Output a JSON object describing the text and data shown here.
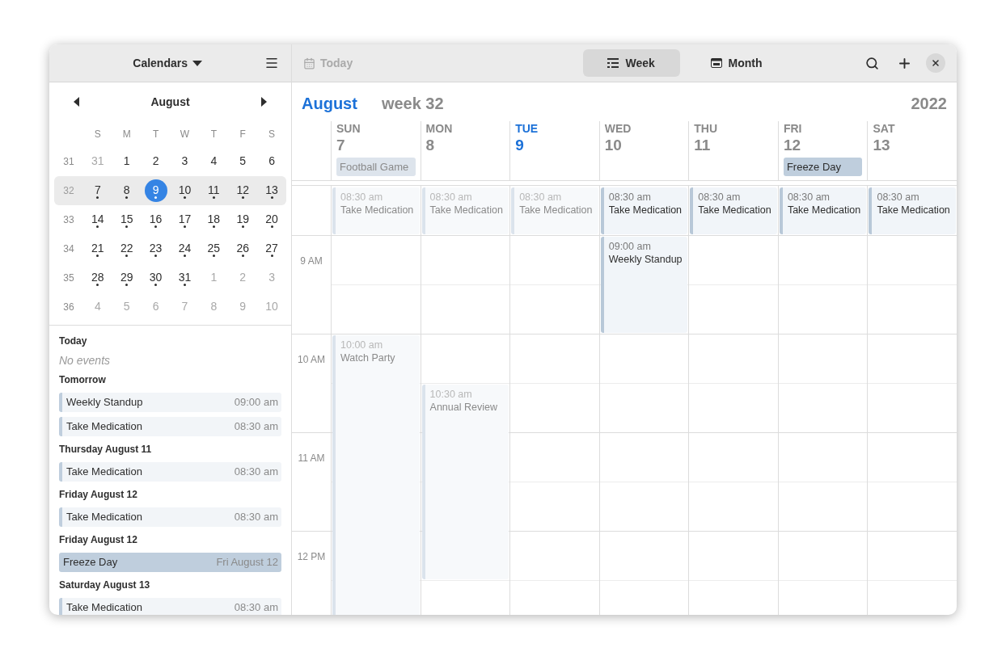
{
  "sidebar": {
    "header": {
      "title": "Calendars"
    },
    "mini_calendar": {
      "month": "August",
      "weekdays": [
        "S",
        "M",
        "T",
        "W",
        "T",
        "F",
        "S"
      ],
      "weeks": [
        {
          "number": "31",
          "current": false,
          "days": [
            {
              "label": "31",
              "other_month": true,
              "has_events": false,
              "selected": false
            },
            {
              "label": "1",
              "other_month": false,
              "has_events": false,
              "selected": false
            },
            {
              "label": "2",
              "other_month": false,
              "has_events": false,
              "selected": false
            },
            {
              "label": "3",
              "other_month": false,
              "has_events": false,
              "selected": false
            },
            {
              "label": "4",
              "other_month": false,
              "has_events": false,
              "selected": false
            },
            {
              "label": "5",
              "other_month": false,
              "has_events": false,
              "selected": false
            },
            {
              "label": "6",
              "other_month": false,
              "has_events": false,
              "selected": false
            }
          ]
        },
        {
          "number": "32",
          "current": true,
          "days": [
            {
              "label": "7",
              "other_month": false,
              "has_events": true,
              "selected": false
            },
            {
              "label": "8",
              "other_month": false,
              "has_events": true,
              "selected": false
            },
            {
              "label": "9",
              "other_month": false,
              "has_events": true,
              "selected": true
            },
            {
              "label": "10",
              "other_month": false,
              "has_events": true,
              "selected": false
            },
            {
              "label": "11",
              "other_month": false,
              "has_events": true,
              "selected": false
            },
            {
              "label": "12",
              "other_month": false,
              "has_events": true,
              "selected": false
            },
            {
              "label": "13",
              "other_month": false,
              "has_events": true,
              "selected": false
            }
          ]
        },
        {
          "number": "33",
          "current": false,
          "days": [
            {
              "label": "14",
              "other_month": false,
              "has_events": true,
              "selected": false
            },
            {
              "label": "15",
              "other_month": false,
              "has_events": true,
              "selected": false
            },
            {
              "label": "16",
              "other_month": false,
              "has_events": true,
              "selected": false
            },
            {
              "label": "17",
              "other_month": false,
              "has_events": true,
              "selected": false
            },
            {
              "label": "18",
              "other_month": false,
              "has_events": true,
              "selected": false
            },
            {
              "label": "19",
              "other_month": false,
              "has_events": true,
              "selected": false
            },
            {
              "label": "20",
              "other_month": false,
              "has_events": true,
              "selected": false
            }
          ]
        },
        {
          "number": "34",
          "current": false,
          "days": [
            {
              "label": "21",
              "other_month": false,
              "has_events": true,
              "selected": false
            },
            {
              "label": "22",
              "other_month": false,
              "has_events": true,
              "selected": false
            },
            {
              "label": "23",
              "other_month": false,
              "has_events": true,
              "selected": false
            },
            {
              "label": "24",
              "other_month": false,
              "has_events": true,
              "selected": false
            },
            {
              "label": "25",
              "other_month": false,
              "has_events": true,
              "selected": false
            },
            {
              "label": "26",
              "other_month": false,
              "has_events": true,
              "selected": false
            },
            {
              "label": "27",
              "other_month": false,
              "has_events": true,
              "selected": false
            }
          ]
        },
        {
          "number": "35",
          "current": false,
          "days": [
            {
              "label": "28",
              "other_month": false,
              "has_events": true,
              "selected": false
            },
            {
              "label": "29",
              "other_month": false,
              "has_events": true,
              "selected": false
            },
            {
              "label": "30",
              "other_month": false,
              "has_events": true,
              "selected": false
            },
            {
              "label": "31",
              "other_month": false,
              "has_events": true,
              "selected": false
            },
            {
              "label": "1",
              "other_month": true,
              "has_events": false,
              "selected": false
            },
            {
              "label": "2",
              "other_month": true,
              "has_events": false,
              "selected": false
            },
            {
              "label": "3",
              "other_month": true,
              "has_events": false,
              "selected": false
            }
          ]
        },
        {
          "number": "36",
          "current": false,
          "days": [
            {
              "label": "4",
              "other_month": true,
              "has_events": false,
              "selected": false
            },
            {
              "label": "5",
              "other_month": true,
              "has_events": false,
              "selected": false
            },
            {
              "label": "6",
              "other_month": true,
              "has_events": false,
              "selected": false
            },
            {
              "label": "7",
              "other_month": true,
              "has_events": false,
              "selected": false
            },
            {
              "label": "8",
              "other_month": true,
              "has_events": false,
              "selected": false
            },
            {
              "label": "9",
              "other_month": true,
              "has_events": false,
              "selected": false
            },
            {
              "label": "10",
              "other_month": true,
              "has_events": false,
              "selected": false
            }
          ]
        }
      ]
    },
    "agenda": [
      {
        "heading": "Today",
        "empty_text": "No events"
      },
      {
        "heading": "Tomorrow",
        "items": [
          {
            "kind": "timed",
            "title": "Weekly Standup",
            "when": "09:00 am"
          },
          {
            "kind": "timed",
            "title": "Take Medication",
            "when": "08:30 am"
          }
        ]
      },
      {
        "heading": "Thursday August 11",
        "items": [
          {
            "kind": "timed",
            "title": "Take Medication",
            "when": "08:30 am"
          }
        ]
      },
      {
        "heading": "Friday August 12",
        "items": [
          {
            "kind": "timed",
            "title": "Take Medication",
            "when": "08:30 am"
          }
        ]
      },
      {
        "heading": "Friday August 12",
        "items": [
          {
            "kind": "all_day",
            "title": "Freeze Day",
            "when": "Fri August 12"
          }
        ]
      },
      {
        "heading": "Saturday August 13",
        "items": [
          {
            "kind": "timed",
            "title": "Take Medication",
            "when": "08:30 am"
          }
        ]
      }
    ]
  },
  "toolbar": {
    "today": {
      "label": "Today",
      "disabled": true
    },
    "views": [
      {
        "label": "Week",
        "selected": true
      },
      {
        "label": "Month",
        "selected": false
      }
    ]
  },
  "week_view": {
    "month": "August",
    "week": "week 32",
    "year": "2022",
    "hours": [
      "9 AM",
      "10 AM",
      "11 AM",
      "12 PM"
    ],
    "days": [
      {
        "name": "SUN",
        "number": "7",
        "today": false,
        "all_day": [
          {
            "title": "Football Game",
            "past": true
          }
        ],
        "events": [
          {
            "time": "08:30 am",
            "title": "Take Medication",
            "kind": "half_hour",
            "past": true
          },
          {
            "time": "10:00 am",
            "title": "Watch Party",
            "kind": "open",
            "past": true
          }
        ]
      },
      {
        "name": "MON",
        "number": "8",
        "today": false,
        "events": [
          {
            "time": "08:30 am",
            "title": "Take Medication",
            "kind": "half_hour",
            "past": true
          },
          {
            "time": "10:30 am",
            "title": "Annual Review",
            "kind": "two_hours",
            "past": true
          }
        ]
      },
      {
        "name": "TUE",
        "number": "9",
        "today": true,
        "events": [
          {
            "time": "08:30 am",
            "title": "Take Medication",
            "kind": "half_hour",
            "past": true
          }
        ]
      },
      {
        "name": "WED",
        "number": "10",
        "today": false,
        "events": [
          {
            "time": "08:30 am",
            "title": "Take Medication",
            "kind": "half_hour",
            "past": false
          },
          {
            "time": "09:00 am",
            "title": "Weekly Standup",
            "kind": "hour",
            "past": false
          }
        ]
      },
      {
        "name": "THU",
        "number": "11",
        "today": false,
        "events": [
          {
            "time": "08:30 am",
            "title": "Take Medication",
            "kind": "half_hour",
            "past": false
          }
        ]
      },
      {
        "name": "FRI",
        "number": "12",
        "today": false,
        "all_day": [
          {
            "title": "Freeze Day",
            "past": false
          }
        ],
        "events": [
          {
            "time": "08:30 am",
            "title": "Take Medication",
            "kind": "half_hour",
            "past": false
          }
        ]
      },
      {
        "name": "SAT",
        "number": "13",
        "today": false,
        "events": [
          {
            "time": "08:30 am",
            "title": "Take Medication",
            "kind": "half_hour",
            "past": false
          }
        ]
      }
    ]
  }
}
